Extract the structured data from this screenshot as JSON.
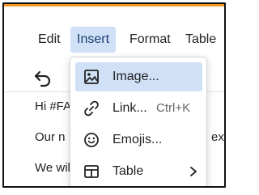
{
  "menubar": {
    "items": [
      "Edit",
      "Insert",
      "Format",
      "Table"
    ],
    "active": "Insert"
  },
  "editor": {
    "lines": [
      "Hi #FA",
      "Our n",
      "We will be encouraging so"
    ],
    "partial_right_text": "ext T"
  },
  "insert_menu": {
    "items": [
      {
        "label": "Image...",
        "icon": "image-icon",
        "active": true
      },
      {
        "label": "Link...",
        "shortcut": "Ctrl+K",
        "icon": "link-icon"
      },
      {
        "label": "Emojis...",
        "icon": "emoji-icon"
      },
      {
        "label": "Table",
        "icon": "table-icon",
        "submenu": true
      }
    ]
  },
  "colors": {
    "accent": "#f59a23",
    "highlight": "#cfe0f7",
    "text": "#222222"
  }
}
